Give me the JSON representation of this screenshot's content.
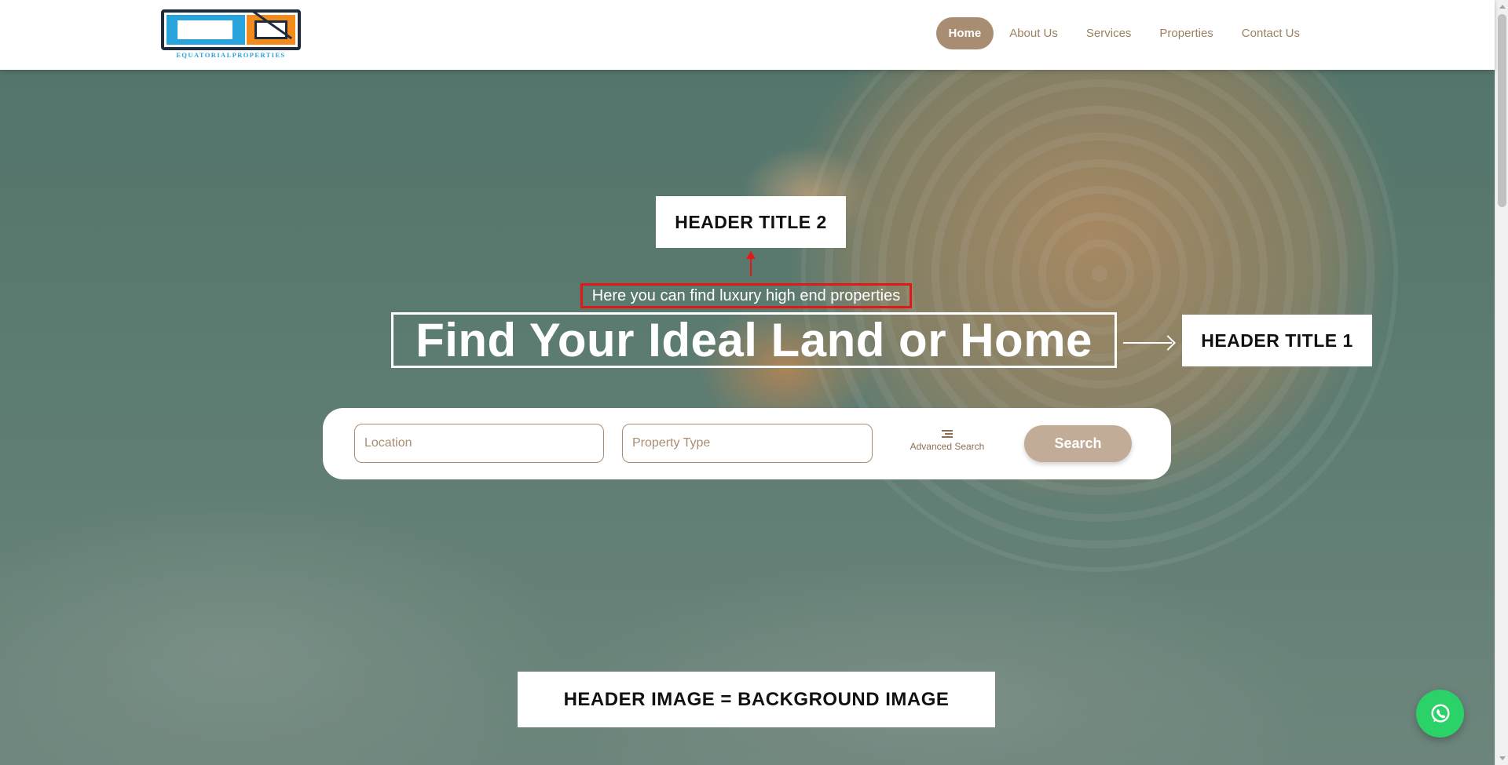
{
  "logo": {
    "text": "EQUATORIALPROPERTIES"
  },
  "nav": {
    "items": [
      {
        "label": "Home",
        "active": true
      },
      {
        "label": "About Us",
        "active": false
      },
      {
        "label": "Services",
        "active": false
      },
      {
        "label": "Properties",
        "active": false
      },
      {
        "label": "Contact Us",
        "active": false
      }
    ]
  },
  "hero": {
    "subtitle": "Here you can find luxury high end properties",
    "headline": "Find Your Ideal Land or Home"
  },
  "annotations": {
    "header_title_2": "HEADER TITLE 2",
    "header_title_1": "HEADER TITLE 1",
    "header_image": "HEADER IMAGE = BACKGROUND IMAGE"
  },
  "search": {
    "location_placeholder": "Location",
    "property_type_placeholder": "Property Type",
    "advanced_label": "Advanced Search",
    "button_label": "Search"
  },
  "whatsapp": {
    "icon": "whatsapp-icon"
  },
  "colors": {
    "accent": "#a98d72",
    "search_button": "#c2ac97",
    "annotation_red": "#e01818",
    "whatsapp_green": "#2ad267",
    "logo_blue": "#29a3dc",
    "logo_orange": "#f28b1e"
  }
}
